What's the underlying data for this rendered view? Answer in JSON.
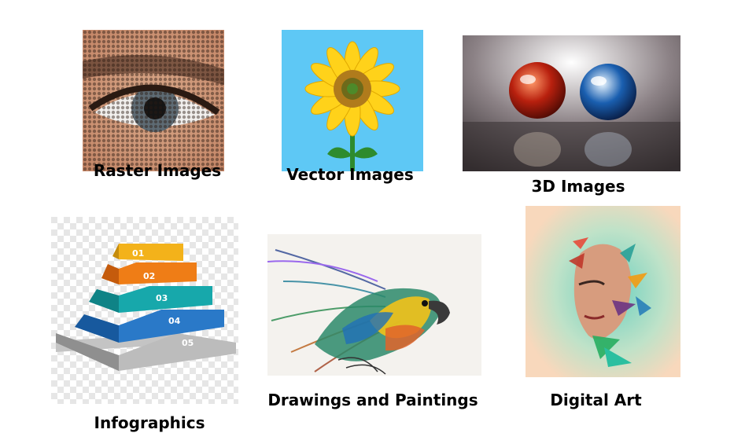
{
  "panels": [
    {
      "id": "raster",
      "label": "Raster Images",
      "icon": "halftone-eye-image"
    },
    {
      "id": "vector",
      "label": "Vector Images",
      "icon": "sunflower-vector-image"
    },
    {
      "id": "threed",
      "label": "3D Images",
      "icon": "glass-spheres-3d-image"
    },
    {
      "id": "infographics",
      "label": "Infographics",
      "icon": "pyramid-infographic-image",
      "steps": [
        "01",
        "02",
        "03",
        "04",
        "05"
      ]
    },
    {
      "id": "drawings",
      "label": "Drawings and Paintings",
      "icon": "parrot-painting-image"
    },
    {
      "id": "digital",
      "label": "Digital Art",
      "icon": "digital-art-portrait-image"
    }
  ],
  "colors": {
    "sky": "#5ec8f5",
    "petal": "#ffd21a",
    "stem": "#2e8b2e",
    "tile_3d_bg": "#6e6466",
    "tile_digital_bg": "#f8d8bc",
    "pyramid": [
      "#f3b21a",
      "#ef7d16",
      "#17a2a6",
      "#1f6fb8",
      "#a9a9a9"
    ]
  }
}
